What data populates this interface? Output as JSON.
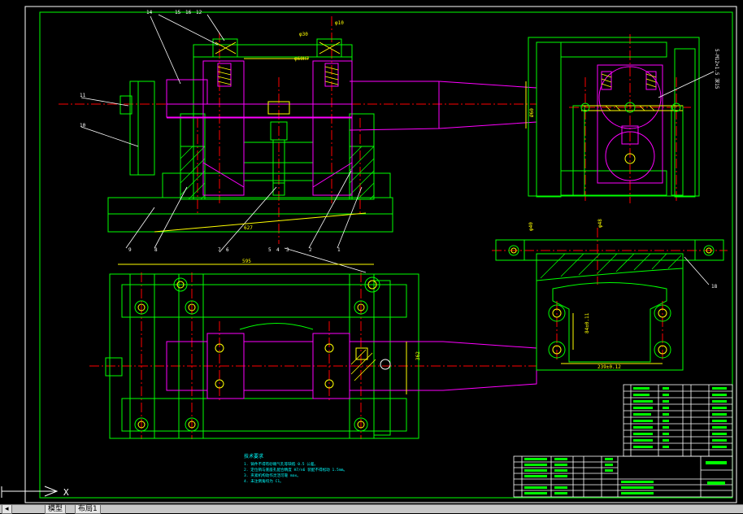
{
  "colors": {
    "background": "#000000",
    "border": "#ffffff",
    "green": "#00ff00",
    "magenta": "#ff00ff",
    "yellow": "#ffff00",
    "red": "#ff0000",
    "cyan": "#00ffff",
    "white": "#ffffff"
  },
  "front_view": {
    "balloons": [
      "14",
      "15",
      "16",
      "12",
      "11",
      "10",
      "9",
      "8",
      "7",
      "6",
      "5",
      "4",
      "3",
      "2",
      "1"
    ],
    "top_dims": [
      "φ30",
      "φ10",
      "φ60H7"
    ],
    "dim_bottom": "627",
    "dim_right": "Ø60",
    "ucs": "X"
  },
  "plan_view": {
    "dim_width": "595",
    "dim_height": "362"
  },
  "side_view": {
    "label": "5-M12×1.5 深15"
  },
  "section_view": {
    "dim_vertical": "84±0.11",
    "dim_horizontal": "239±0.12",
    "balloon": "18",
    "top_dims": [
      "φ40",
      "φ48"
    ]
  },
  "notes": {
    "title": "技术要求",
    "lines": [
      "1. 铸件不得有砂眼气孔等缺陷 0.5 公差。",
      "2. 定位销与底座孔配合精度 H7/n6 装配不得松动 1.5mm。",
      "3. 夹紧机构动作灵活可靠 max。",
      "4. 未注倒角均为 C1。"
    ]
  },
  "tabs": {
    "model": "模型",
    "layout1": "布局1"
  }
}
